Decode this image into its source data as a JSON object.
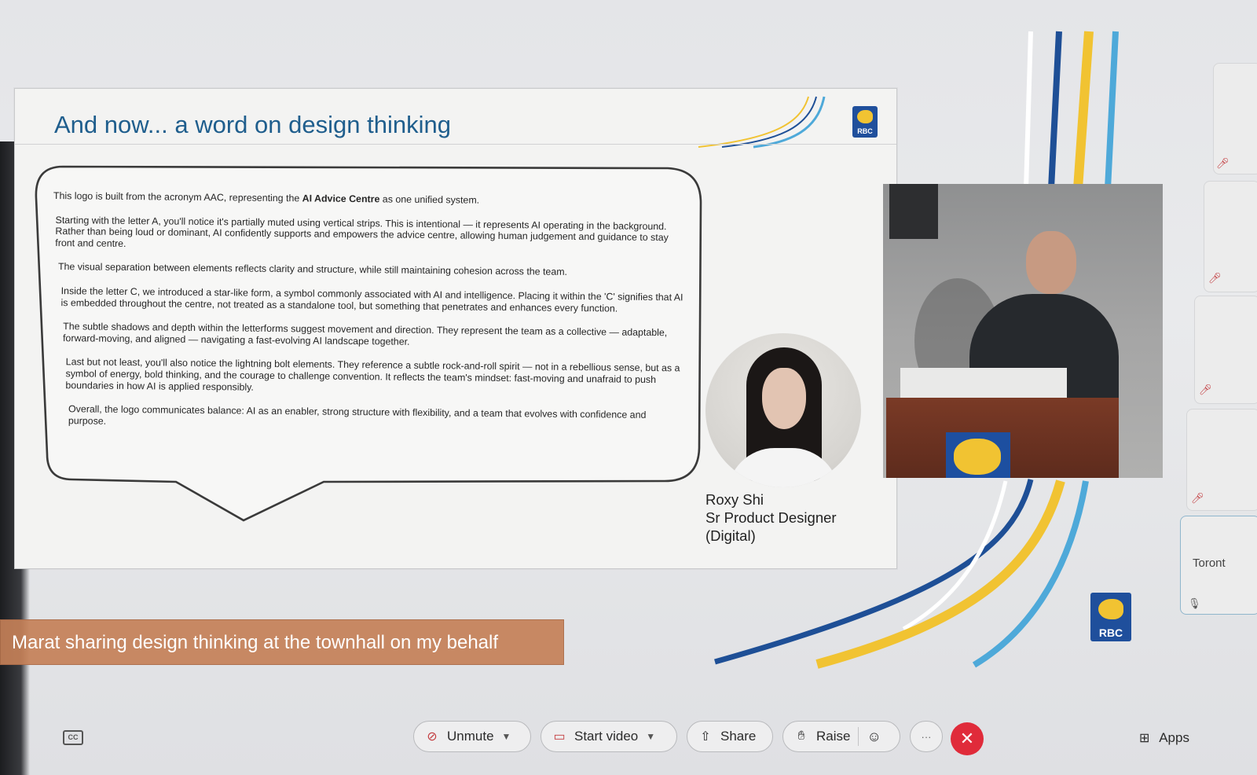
{
  "slide": {
    "title": "And now... a word on design thinking",
    "logo_text": "RBC",
    "paragraphs": [
      [
        "This logo is built from the acronym AAC, representing the ",
        "AI Advice Centre",
        " as one unified system."
      ],
      [
        "Starting with the letter A, you'll notice it's partially muted using vertical strips. This is intentional — it represents AI operating in the background. Rather than being loud or dominant, AI confidently supports and empowers the advice centre, allowing human judgement and guidance to stay front and centre.",
        "",
        ""
      ],
      [
        "The visual separation between elements reflects clarity and structure, while still maintaining cohesion across the team.",
        "",
        ""
      ],
      [
        "Inside the letter C, we introduced a star-like form, a symbol commonly associated with AI and intelligence. Placing it within the 'C' signifies that AI is embedded throughout the centre, not treated as a standalone tool, but something that penetrates and enhances every function.",
        "",
        ""
      ],
      [
        "The subtle shadows and depth within the letterforms suggest movement and direction. They represent the team as a collective — adaptable, forward-moving, and aligned — navigating a fast-evolving AI landscape together.",
        "",
        ""
      ],
      [
        "Last but not least, you'll also notice the lightning bolt elements. They reference a subtle rock-and-roll spirit — not in a rebellious sense, but as a symbol of energy, bold thinking, and the courage to challenge convention. It reflects the team's mindset: fast-moving and unafraid to push boundaries in how AI is applied responsibly.",
        "",
        ""
      ],
      [
        "Overall, the logo communicates balance: AI as an enabler, strong structure with flexibility, and a team that evolves with confidence and purpose.",
        "",
        ""
      ]
    ],
    "caption": {
      "name": "Roxy Shi",
      "role": "Sr Product Designer",
      "dept": "(Digital)"
    }
  },
  "side_panel": {
    "location_label": "Toront"
  },
  "stage_logo_text": "RBC",
  "overlay_caption": "Marat sharing design thinking at the townhall on my behalf",
  "toolbar": {
    "cc_label": "CC",
    "unmute_label": "Unmute",
    "start_video_label": "Start video",
    "share_label": "Share",
    "raise_label": "Raise",
    "more_label": "···",
    "leave_label": "✕",
    "apps_label": "Apps"
  },
  "colors": {
    "brand_blue": "#1f4f9c",
    "brand_yellow": "#f1c332",
    "title_blue": "#1f5e8d",
    "leave_red": "#e02b3a",
    "caption_bg": "#c48058"
  },
  "icons": {
    "unmute": "mic-off-icon",
    "start_video": "video-off-icon",
    "share": "share-screen-icon",
    "raise": "raise-hand-icon",
    "reactions": "emoji-icon",
    "apps": "apps-grid-icon",
    "cc": "closed-captions-icon"
  }
}
